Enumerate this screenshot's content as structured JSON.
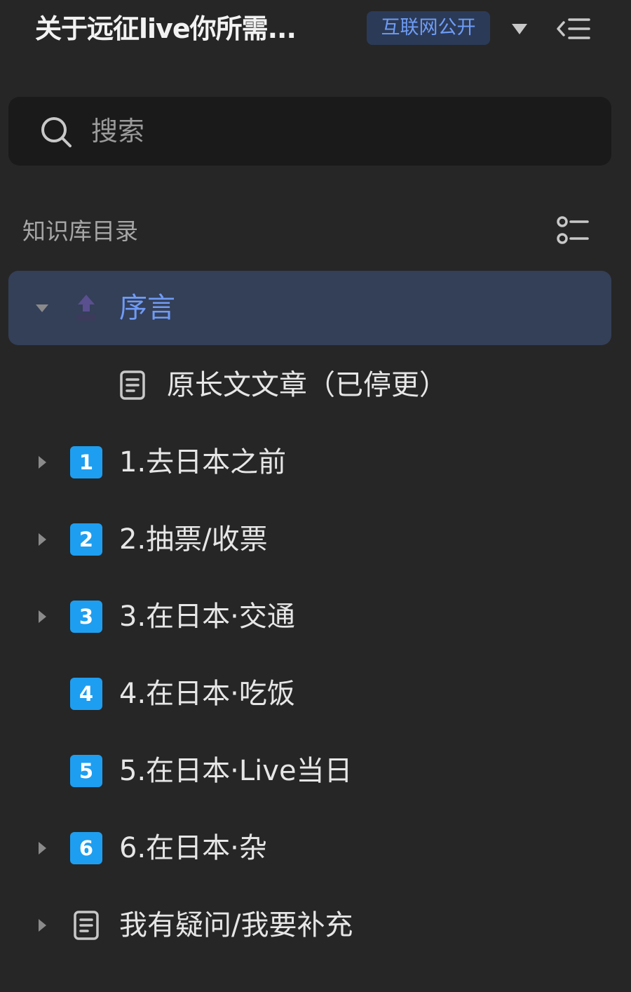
{
  "header": {
    "title": "关于远征live你所需...",
    "badge": "互联网公开"
  },
  "search": {
    "placeholder": "搜索"
  },
  "section": {
    "title": "知识库目录"
  },
  "tree": {
    "items": [
      {
        "label": "序言",
        "icon": "top-icon",
        "expanded": true,
        "active": true
      },
      {
        "label": "原长文文章（已停更）",
        "icon": "document-icon",
        "child": true
      },
      {
        "label": "1.去日本之前",
        "icon_text": "1",
        "has_children": true
      },
      {
        "label": "2.抽票/收票",
        "icon_text": "2",
        "has_children": true
      },
      {
        "label": "3.在日本·交通",
        "icon_text": "3",
        "has_children": true
      },
      {
        "label": "4.在日本·吃饭",
        "icon_text": "4",
        "has_children": false
      },
      {
        "label": "5.在日本·Live当日",
        "icon_text": "5",
        "has_children": false
      },
      {
        "label": "6.在日本·杂",
        "icon_text": "6",
        "has_children": true
      },
      {
        "label": "我有疑问/我要补充",
        "icon": "document-icon",
        "has_children": true
      }
    ]
  },
  "colors": {
    "background": "#262626",
    "accent": "#6f9bf6",
    "active_row": "#343f58",
    "number_icon": "#1e9ef0"
  }
}
